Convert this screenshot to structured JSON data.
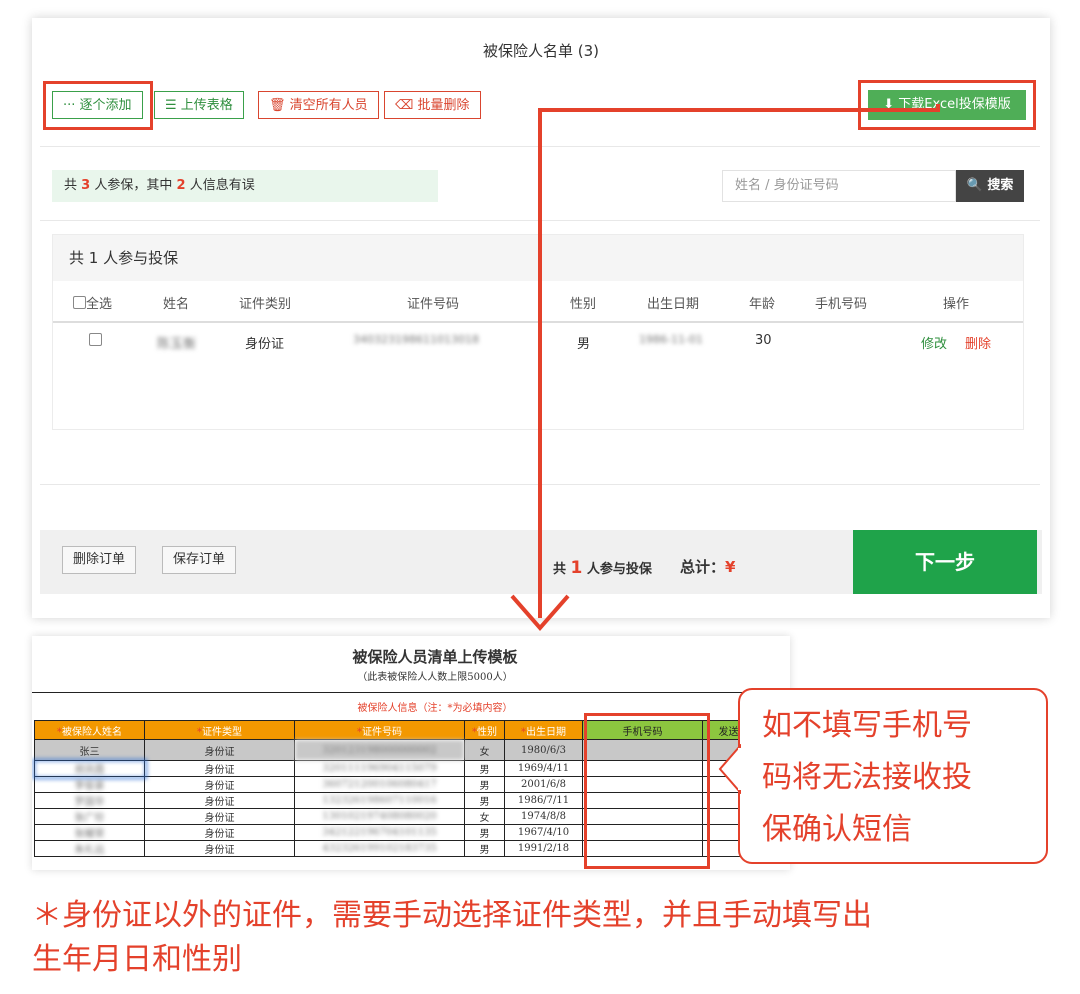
{
  "panel": {
    "title": "被保险人名单 (3)",
    "buttons": {
      "add_one": "··· 逐个添加",
      "upload": "☰ 上传表格",
      "clear_all": "🗑 清空所有人员",
      "batch_delete": "⌫ 批量删除",
      "download_template": "⬇ 下载Excel投保模版"
    },
    "summary": {
      "prefix": "共",
      "total": "3",
      "middle": "人参保，其中",
      "errors": "2",
      "suffix": "人信息有误"
    },
    "search": {
      "placeholder": "姓名 / 身份证号码",
      "button": "🔍 搜索"
    },
    "list": {
      "heading": "共 1 人参与投保",
      "columns": {
        "select_all": "全选",
        "name": "姓名",
        "id_type": "证件类别",
        "id_number": "证件号码",
        "gender": "性别",
        "birth": "出生日期",
        "age": "年龄",
        "phone": "手机号码",
        "actions": "操作"
      },
      "row": {
        "name": "陈玉衡",
        "id_type": "身份证",
        "id_number": "340323198611013018",
        "gender": "男",
        "birth": "1986-11-01",
        "age": "30",
        "edit": "修改",
        "delete": "删除"
      }
    },
    "footer": {
      "delete_order": "删除订单",
      "save_order": "保存订单",
      "count_prefix": "共",
      "count": "1",
      "count_suffix": "人参与投保",
      "total_label": "总计：",
      "currency": "¥",
      "next": "下一步"
    }
  },
  "excel": {
    "title": "被保险人员清单上传模板",
    "subtitle": "（此表被保险人人数上限5000人）",
    "section": "被保险人信息（注：*为必填内容）",
    "headers": [
      "被保险人姓名",
      "证件类型",
      "证件号码",
      "性别",
      "出生日期",
      "手机号码",
      "发送"
    ],
    "rows": [
      {
        "name": "张三",
        "type": "身份证",
        "id": "320123198000000002",
        "gender": "女",
        "birth": "1980/6/3"
      },
      {
        "name": "郑凤霞",
        "type": "身份证",
        "id": "320111196904115079",
        "gender": "男",
        "birth": "1969/4/11"
      },
      {
        "name": "李俊豪",
        "type": "身份证",
        "id": "360721200106080417",
        "gender": "男",
        "birth": "2001/6/8"
      },
      {
        "name": "罗国华",
        "type": "身份证",
        "id": "132326198607110016",
        "gender": "男",
        "birth": "1986/7/11"
      },
      {
        "name": "张广珍",
        "type": "身份证",
        "id": "130102197408080020",
        "gender": "女",
        "birth": "1974/8/8"
      },
      {
        "name": "张耀荣",
        "type": "身份证",
        "id": "342122196704101135",
        "gender": "男",
        "birth": "1967/4/10"
      },
      {
        "name": "朱礼远",
        "type": "身份证",
        "id": "432326199102183735",
        "gender": "男",
        "birth": "1991/2/18"
      }
    ]
  },
  "callout": {
    "line1": "如不填写手机号",
    "line2": "码将无法接收投",
    "line3": "保确认短信"
  },
  "footnote": {
    "line1": "＊身份证以外的证件，需要手动选择证件类型，并且手动填写出",
    "line2": "生年月日和性别"
  },
  "colors": {
    "accent_red": "#e4412b",
    "green": "#1fa34a",
    "orange_header": "#f39800",
    "phone_header": "#8cc63f"
  }
}
